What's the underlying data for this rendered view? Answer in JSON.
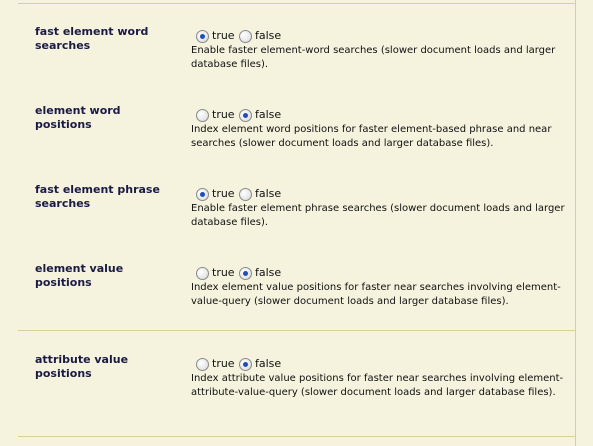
{
  "settings": [
    {
      "label": "fast element word searches",
      "true_label": "true",
      "false_label": "false",
      "selected": "true",
      "description": "Enable faster element-word searches (slower document loads and larger database files)."
    },
    {
      "label": "element word positions",
      "true_label": "true",
      "false_label": "false",
      "selected": "false",
      "description": "Index element word positions for faster element-based phrase and near searches (slower document loads and larger database files)."
    },
    {
      "label": "fast element phrase searches",
      "true_label": "true",
      "false_label": "false",
      "selected": "true",
      "description": "Enable faster element phrase searches (slower document loads and larger database files)."
    },
    {
      "label": "element value positions",
      "true_label": "true",
      "false_label": "false",
      "selected": "false",
      "description": "Index element value positions for faster near searches involving element-value-query (slower document loads and larger database files)."
    },
    {
      "label": "attribute value positions",
      "true_label": "true",
      "false_label": "false",
      "selected": "false",
      "description": "Index attribute value positions for faster near searches involving element-attribute-value-query (slower document loads and larger database files)."
    }
  ]
}
